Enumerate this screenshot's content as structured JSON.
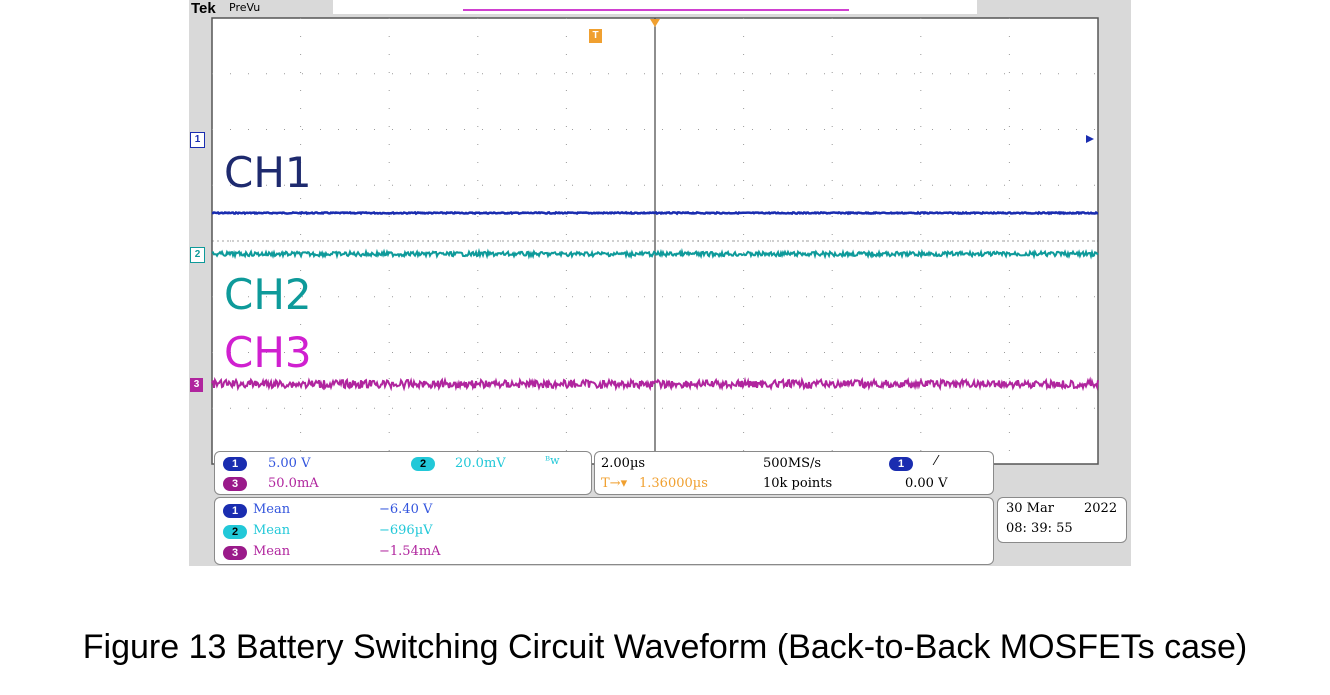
{
  "chart_data": {
    "type": "line",
    "title": "",
    "xlabel": "",
    "ylabel": "",
    "grid": true,
    "series": [
      {
        "name": "CH1",
        "color": "#1a2db0",
        "mean": -6.4
      },
      {
        "name": "CH2",
        "color": "#0e9a9a",
        "mean": -0.000696
      },
      {
        "name": "CH3",
        "color": "#b0259e",
        "mean": -0.00154
      }
    ],
    "annotations": [
      "CH1",
      "CH2",
      "CH3"
    ]
  },
  "scope": {
    "brand": "Tek",
    "mode": "PreVu",
    "ch1_scale": "5.00 V",
    "ch2_scale": "20.0mV",
    "ch2_bw": "ᴮw",
    "ch3_scale": "50.0mA",
    "timebase": "2.00µs",
    "trigger_pos": "1.36000µs",
    "sample_rate": "500MS/s",
    "record": "10k points",
    "trig_level": "0.00 V",
    "trig_slope": "⁄",
    "measurements": [
      {
        "ch": "1",
        "label": "Mean",
        "value": "−6.40 V"
      },
      {
        "ch": "2",
        "label": "Mean",
        "value": "−696µV"
      },
      {
        "ch": "3",
        "label": "Mean",
        "value": "−1.54mA"
      }
    ],
    "date": "30 Mar",
    "year": "2022",
    "time": "08: 39: 55"
  },
  "colors": {
    "ch1": "#1a2db0",
    "ch2": "#0e9a9a",
    "ch3": "#b0259e",
    "ch1_text": "#3355dd",
    "ch2_text": "#22c8d8",
    "ch3_text": "#b0259e",
    "trigger": "#f0a030"
  },
  "caption": "Figure 13 Battery Switching Circuit Waveform (Back-to-Back MOSFETs case)"
}
